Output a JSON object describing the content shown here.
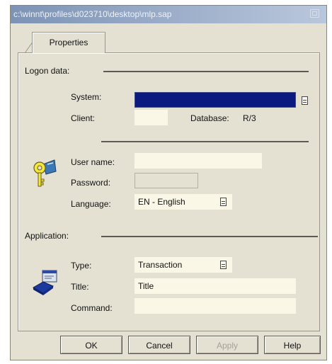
{
  "window": {
    "title": "c:\\winnt\\profiles\\d023710\\desktop\\mlp.sap"
  },
  "tab": {
    "label": "Properties"
  },
  "logon": {
    "section_label": "Logon data:",
    "system_label": "System:",
    "system_value": "",
    "client_label": "Client:",
    "client_value": "",
    "database_label": "Database:",
    "database_value": "R/3",
    "user_label": "User name:",
    "user_value": "",
    "password_label": "Password:",
    "language_label": "Language:",
    "language_value": "EN - English",
    "key_icon": "key-icon"
  },
  "application": {
    "section_label": "Application:",
    "type_label": "Type:",
    "type_value": "Transaction",
    "title_label": "Title:",
    "title_value": "Title",
    "command_label": "Command:",
    "command_value": "",
    "icon": "transaction-icon"
  },
  "buttons": {
    "ok": "OK",
    "cancel": "Cancel",
    "apply": "Apply",
    "help": "Help"
  },
  "colors": {
    "selected_field": "#0b1a7e",
    "input_bg": "#faf7e6",
    "dialog_bg": "#e4e1d3"
  }
}
